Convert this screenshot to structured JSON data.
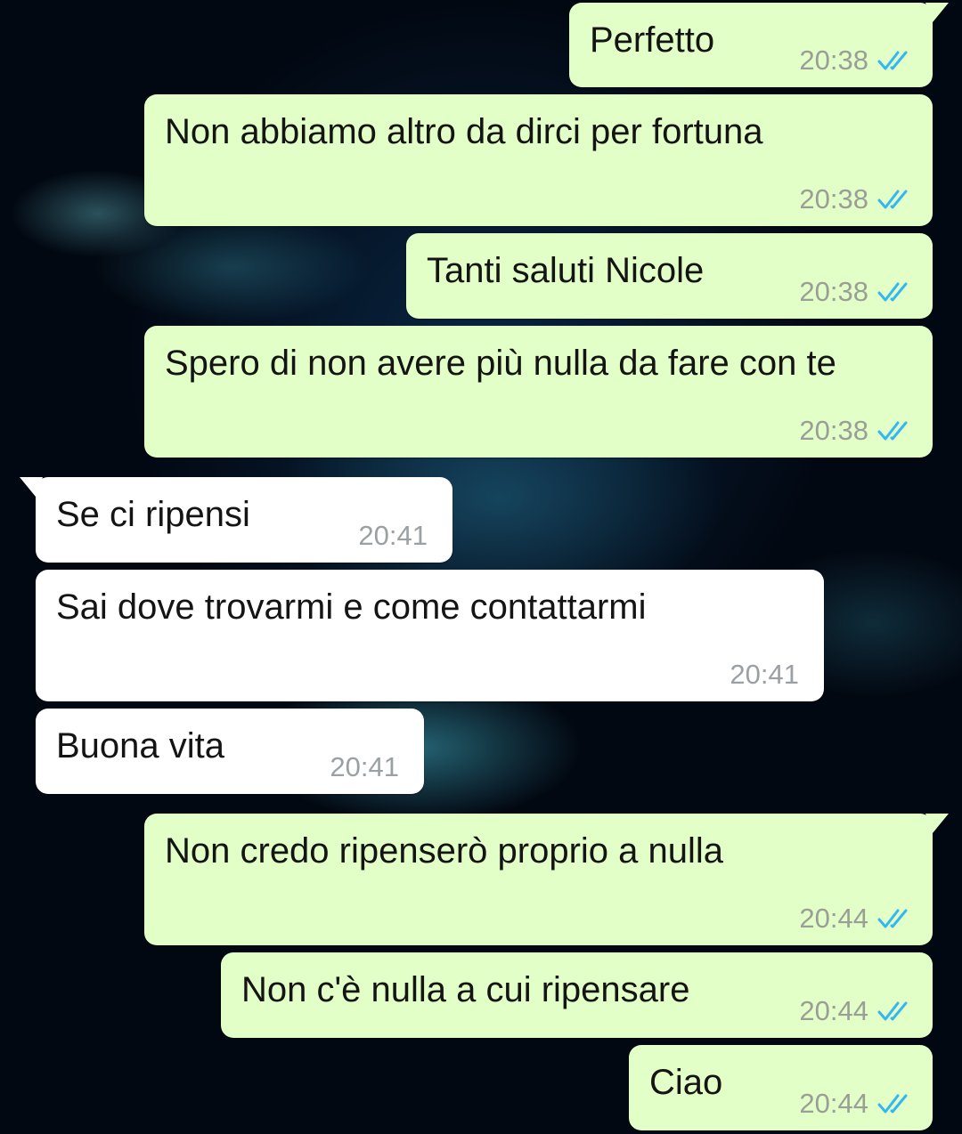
{
  "chat": {
    "messages": [
      {
        "text": "Perfetto",
        "time": "20:38"
      },
      {
        "text": "Non abbiamo altro da dirci per fortuna",
        "time": "20:38"
      },
      {
        "text": "Tanti saluti Nicole",
        "time": "20:38"
      },
      {
        "text": "Spero di non avere più nulla da fare con te",
        "time": "20:38"
      },
      {
        "text": "Se ci ripensi",
        "time": "20:41"
      },
      {
        "text": "Sai dove trovarmi e come contattarmi",
        "time": "20:41"
      },
      {
        "text": "Buona vita",
        "time": "20:41"
      },
      {
        "text": "Non credo ripenserò proprio a nulla",
        "time": "20:44"
      },
      {
        "text": "Non c'è nulla a cui ripensare",
        "time": "20:44"
      },
      {
        "text": "Ciao",
        "time": "20:44"
      }
    ]
  },
  "colors": {
    "outgoing_bubble": "#e2ffc7",
    "incoming_bubble": "#ffffff",
    "read_ticks": "#34b7f1"
  },
  "icons": {
    "status": "double-check-read-icon"
  }
}
